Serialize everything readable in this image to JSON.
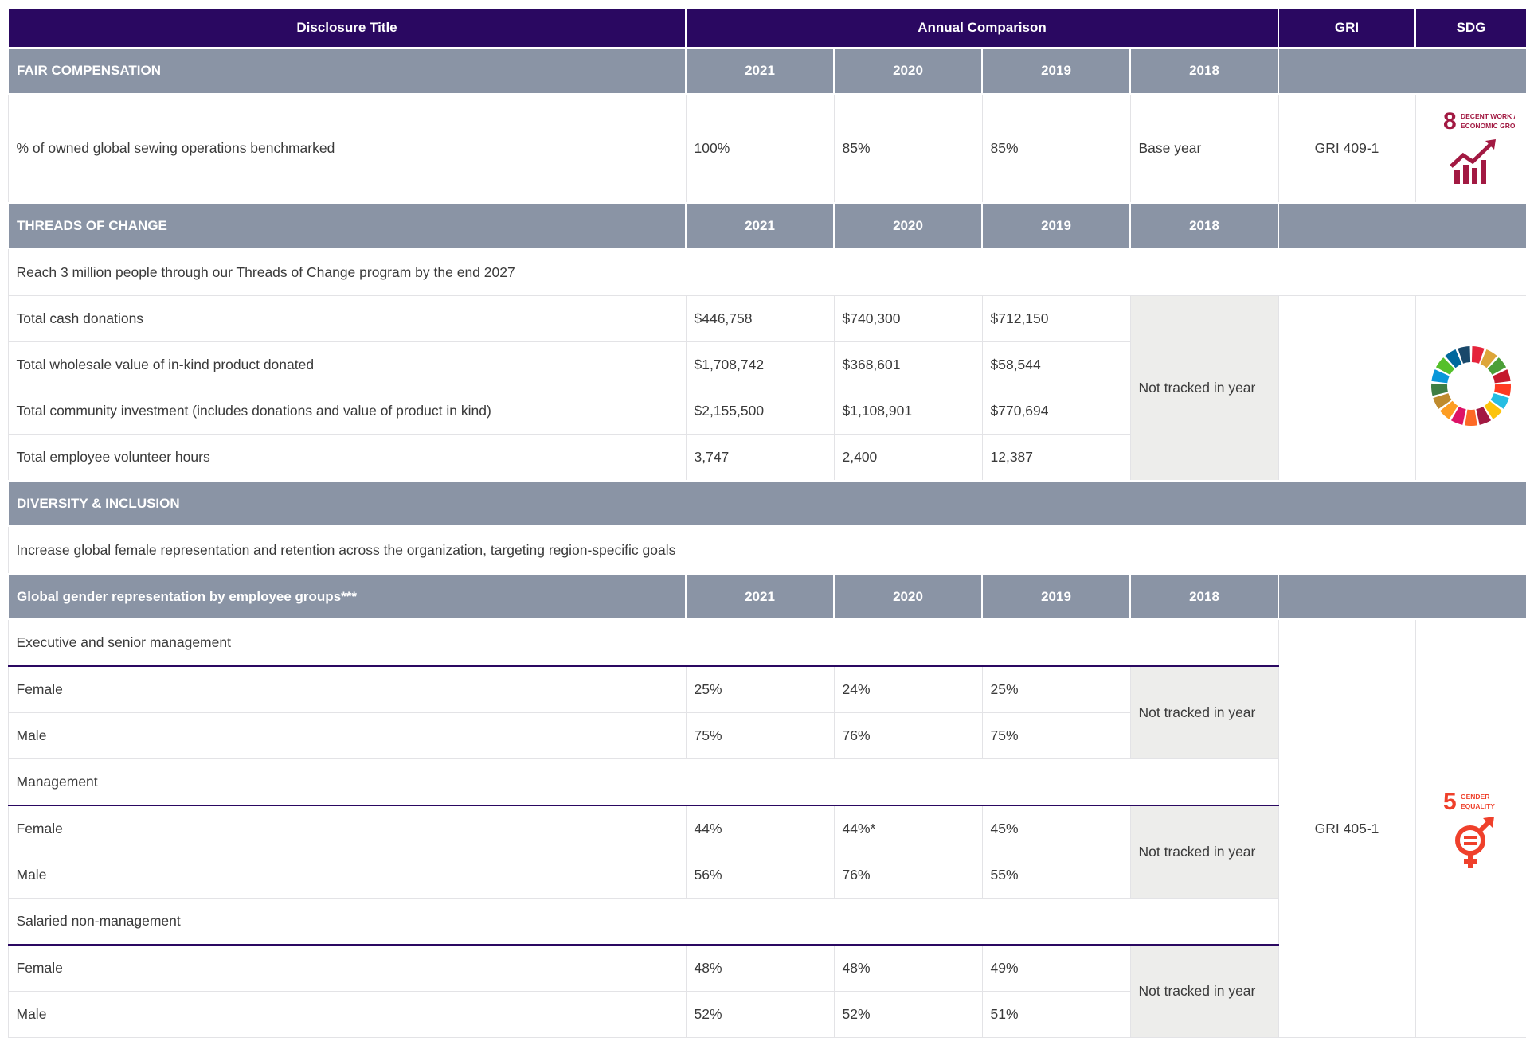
{
  "header": {
    "disclosure_title": "Disclosure Title",
    "annual_comparison": "Annual Comparison",
    "gri": "GRI",
    "sdg": "SDG"
  },
  "sections": {
    "fair_compensation": {
      "title": "FAIR COMPENSATION",
      "years": [
        "2021",
        "2020",
        "2019",
        "2018"
      ],
      "row": {
        "label": "% of owned global sewing operations benchmarked",
        "values": [
          "100%",
          "85%",
          "85%",
          "Base year"
        ],
        "gri": "GRI 409-1"
      },
      "sdg": {
        "number": "8",
        "line1": "DECENT WORK AND",
        "line2": "ECONOMIC GROWTH",
        "color": "#a21942"
      }
    },
    "threads_of_change": {
      "title": "THREADS OF CHANGE",
      "years": [
        "2021",
        "2020",
        "2019",
        "2018"
      ],
      "goal": "Reach 3 million people  through our Threads of Change program by the end 2027",
      "rows": [
        {
          "label": "Total cash donations",
          "values": [
            "$446,758",
            "$740,300",
            "$712,150"
          ]
        },
        {
          "label": "Total wholesale value of in-kind product donated",
          "values": [
            "$1,708,742",
            "$368,601",
            "$58,544"
          ]
        },
        {
          "label": "Total community investment (includes donations and value of product in kind)",
          "values": [
            "$2,155,500",
            "$1,108,901",
            "$770,694"
          ]
        },
        {
          "label": "Total employee volunteer hours",
          "values": [
            "3,747",
            "2,400",
            "12,387"
          ]
        }
      ],
      "not_tracked": "Not tracked in year"
    },
    "diversity": {
      "title": "DIVERSITY & INCLUSION",
      "goal": "Increase global female representation and retention across the organization, targeting region-specific goals",
      "subheader": "Global gender representation by employee groups***",
      "years": [
        "2021",
        "2020",
        "2019",
        "2018"
      ],
      "groups": [
        {
          "name": "Executive and senior management",
          "rows": [
            {
              "label": "Female",
              "values": [
                "25%",
                "24%",
                "25%"
              ]
            },
            {
              "label": "Male",
              "values": [
                "75%",
                "76%",
                "75%"
              ]
            }
          ]
        },
        {
          "name": "Management",
          "rows": [
            {
              "label": "Female",
              "values": [
                "44%",
                "44%*",
                "45%"
              ]
            },
            {
              "label": "Male",
              "values": [
                "56%",
                "76%",
                "55%"
              ]
            }
          ]
        },
        {
          "name": "Salaried non-management",
          "rows": [
            {
              "label": "Female",
              "values": [
                "48%",
                "48%",
                "49%"
              ]
            },
            {
              "label": "Male",
              "values": [
                "52%",
                "52%",
                "51%"
              ]
            }
          ]
        }
      ],
      "not_tracked": "Not tracked in year",
      "gri": "GRI 405-1",
      "sdg": {
        "number": "5",
        "line1": "GENDER",
        "line2": "EQUALITY",
        "color": "#ef402b"
      }
    }
  },
  "colors": {
    "header_bg": "#2a0861",
    "section_bg": "#8a94a5",
    "not_tracked_bg": "#ededeb"
  },
  "icons": [
    "sdg-8-icon",
    "sdg-wheel-icon",
    "sdg-5-icon"
  ]
}
